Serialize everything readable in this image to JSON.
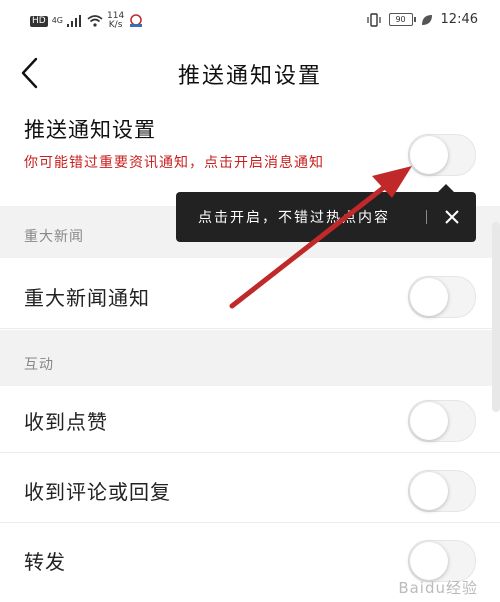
{
  "status_bar": {
    "hd": "HD",
    "network": "4G",
    "speed_value": "114",
    "speed_unit": "K/s",
    "battery": "90",
    "time": "12:46"
  },
  "header": {
    "title": "推送通知设置",
    "back_icon": "chevron-left-icon"
  },
  "main_setting": {
    "label": "推送通知设置",
    "hint": "你可能错过重要资讯通知，点击开启消息通知",
    "enabled": false
  },
  "tooltip": {
    "text": "点击开启，不错过热点内容",
    "close_icon": "close-icon"
  },
  "sections": [
    {
      "title": "重大新闻",
      "items": [
        {
          "label": "重大新闻通知",
          "enabled": false
        }
      ]
    },
    {
      "title": "互动",
      "items": [
        {
          "label": "收到点赞",
          "enabled": false
        },
        {
          "label": "收到评论或回复",
          "enabled": false
        },
        {
          "label": "转发",
          "enabled": false
        }
      ]
    }
  ],
  "watermark": "Baidu经验",
  "colors": {
    "hint_red": "#c8201e",
    "section_bg": "#f2f2f2",
    "tooltip_bg": "#222222",
    "annotation_arrow": "#c0282a"
  }
}
